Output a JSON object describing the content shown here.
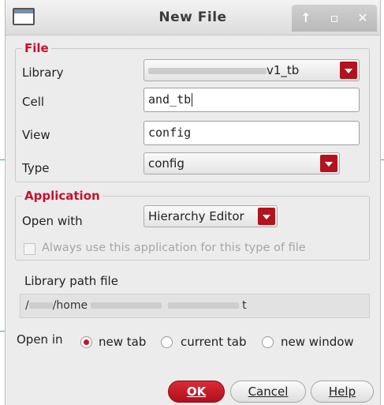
{
  "window": {
    "title": "New File"
  },
  "file_group": {
    "title": "File",
    "library_label": "Library",
    "library_value": "v1_tb",
    "cell_label": "Cell",
    "cell_value": "and_tb",
    "view_label": "View",
    "view_value": "config",
    "type_label": "Type",
    "type_value": "config"
  },
  "application_group": {
    "title": "Application",
    "open_with_label": "Open with",
    "open_with_value": "Hierarchy Editor",
    "always_use_label": "Always use this application for this type of file",
    "always_use_checked": false
  },
  "library_path": {
    "label": "Library path file",
    "value_visible_start": "/",
    "value_visible_mid": "/home",
    "value_visible_end": "t"
  },
  "open_in": {
    "label": "Open in",
    "options": [
      "new tab",
      "current tab",
      "new window"
    ],
    "selected": "new tab"
  },
  "buttons": {
    "ok": "OK",
    "cancel": "Cancel",
    "help": "Help"
  },
  "colors": {
    "accent": "#c8102e",
    "window_bg": "#ececec"
  },
  "icons": {
    "titlebar": [
      "window-icon",
      "maximize-arrow-icon",
      "restore-icon",
      "close-icon"
    ],
    "combo": "chevron-down-icon"
  }
}
